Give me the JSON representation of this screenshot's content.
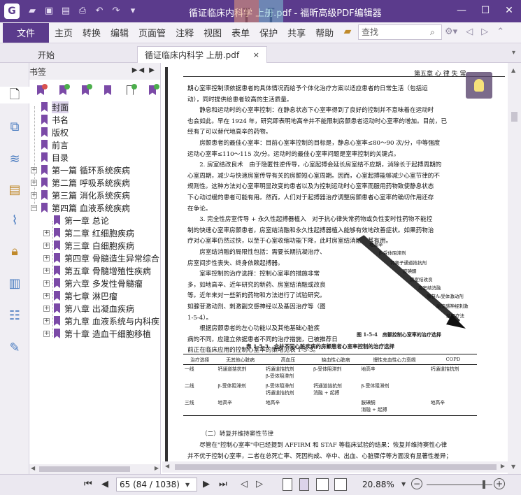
{
  "titlebar": {
    "title": "循证临床内科学 上册.pdf - 福昕高级PDF编辑器",
    "logo": "G",
    "quick_access": [
      "folder-open-icon",
      "save-icon",
      "save-as-icon",
      "print-icon",
      "undo-icon",
      "redo-icon",
      "customize-dropdown-icon"
    ],
    "watermark_left": "I",
    "watermark_right": "I",
    "controls": [
      "minimize",
      "maximize",
      "close"
    ]
  },
  "menu": {
    "file": "文件",
    "items": [
      "主页",
      "转换",
      "编辑",
      "页面管",
      "注释",
      "视图",
      "表单",
      "保护",
      "共享",
      "帮助"
    ],
    "search_placeholder": "查找"
  },
  "tabs": {
    "home": "开始",
    "doc": "循证临床内科学 上册.pdf",
    "close_glyph": "×"
  },
  "bookmarks": {
    "header": "书签",
    "controls": "▶◀ ▶",
    "items": [
      {
        "label": "封面",
        "level": 0,
        "selected": true,
        "expandable": false
      },
      {
        "label": "书名",
        "level": 0,
        "expandable": false
      },
      {
        "label": "版权",
        "level": 0,
        "expandable": false
      },
      {
        "label": "前言",
        "level": 0,
        "expandable": false
      },
      {
        "label": "目录",
        "level": 0,
        "expandable": false
      },
      {
        "label": "第一篇 循环系统疾病",
        "level": 0,
        "expandable": true,
        "expanded": false
      },
      {
        "label": "第二篇 呼吸系统疾病",
        "level": 0,
        "expandable": true,
        "expanded": false
      },
      {
        "label": "第三篇 消化系统疾病",
        "level": 0,
        "expandable": true,
        "expanded": false
      },
      {
        "label": "第四篇 血液系统疾病",
        "level": 0,
        "expandable": true,
        "expanded": true
      },
      {
        "label": "第一章 总论",
        "level": 1,
        "expandable": false
      },
      {
        "label": "第二章 红细胞疾病",
        "level": 1,
        "expandable": true,
        "expanded": false
      },
      {
        "label": "第三章 白细胞疾病",
        "level": 1,
        "expandable": true,
        "expanded": false
      },
      {
        "label": "第四章 骨髓造生异常综合",
        "level": 1,
        "expandable": true,
        "expanded": false
      },
      {
        "label": "第五章 骨髓增殖性疾病",
        "level": 1,
        "expandable": true,
        "expanded": false
      },
      {
        "label": "第六章 多发性骨髓瘤",
        "level": 1,
        "expandable": true,
        "expanded": false
      },
      {
        "label": "第七章 淋巴瘤",
        "level": 1,
        "expandable": true,
        "expanded": false
      },
      {
        "label": "第八章 出凝血疾病",
        "level": 1,
        "expandable": true,
        "expanded": false
      },
      {
        "label": "第九章 血液系统与内科疾",
        "level": 1,
        "expandable": true,
        "expanded": false
      },
      {
        "label": "第十章 造血干细胞移植",
        "level": 1,
        "expandable": true,
        "expanded": false
      }
    ]
  },
  "document": {
    "running_head": "第五章  心 律 失 常",
    "paragraphs": [
      "期心室率控制须依据患者的具体情况而给予个体化治疗方案以适应患者的日常生活（包括运",
      "动），同时提供给患者较高的生活质量。",
      "　　静息和运动时的心室率控制：在静息状态下心室率得到了良好的控制并不意味着在运动时",
      "也会如此。早在 1924 年，研究即表明地高辛并不能限制房颤患者运动时心室率的增加。目前，已",
      "经有了可以替代地高辛的药物。",
      "　　房颤患者的最佳心室率：目前心室率控制的目标是，静息心室率≤80～90 次/分，中等强度",
      "运动心室率≤110～115 次/分。运动时的最佳心室率问题是室率控制的关键点。",
      "　　2. 房室结改良术　由于隐匿性逆传导，心室起搏会延长房室结不应期，消除长于起搏周期的",
      "心室周期，减少与快速房室传导有关的房颤短心室周期。因而，心室起搏能够减少心室节律的不",
      "规则性。这种方法对心室率明显改变的患者以及为控制运动时心室率而服用药物致使静息状态",
      "下心动过缓的患者可能有用。然而，人们对于起搏器治疗调整房颤患者心室率的确切作用还存",
      "在争论。",
      "　　3. 完全性房室传导 + 永久性起搏器植入　对于抗心律失常药物或负性变时性药物不能控",
      "制的快速心室率房颤患者，房室结消融和永久性起搏器植入能够有效地改善症状。如果药物治",
      "疗对心室率仍然过快，以至于心室收缩功能下降，此时房室结消融尤其有用。",
      "　　房室结消融的局限性包括：需要长期抗凝治疗、",
      "房室间步性丧失、终身依赖起搏器。",
      "　　室率控制的治疗选择：控制心室率的措施非常",
      "多，如地高辛、近年研究的新药、房室结消融或改良",
      "等。近年来对一些新的药物和方法进行了试验研究。",
      "如腺苷激动剂、刺激副交感神经以及基因治疗等（图",
      "1-5-4）。",
      "　　根据房颤患者的左心功能以及其他基础心脏疾",
      "病的不同，应建立依据患者不同的治疗措施，已被推荐日",
      "前正在临床应用的控制心室率的策略见表 1-5-3。"
    ],
    "figure_labels": [
      "地高辛",
      "β-受体阻滞剂",
      "钙离子通道拮抗剂",
      "胺碘酮",
      "房室结改良",
      "房室结消融",
      "腺苷A₁受体激动剂",
      "副交感神经刺激",
      "基因疗法"
    ],
    "figure_caption": "图 1-5-4　房颤控制心室率的治疗选择",
    "table_caption": "表 1-5-3　合并不同心脏疾病的房颤患者心室率控制的治疗选择",
    "table": {
      "headers": [
        "治疗选择",
        "无其他心脏病",
        "高血压",
        "缺血性心脏病",
        "慢性充血性心力衰竭",
        "COPD"
      ],
      "rows": [
        [
          "一线",
          "钙通道拮抗剂",
          "钙通道拮抗剂\nβ-受体阻滞剂",
          "β-受体阻滞剂",
          "地高辛",
          "钙通道拮抗剂"
        ],
        [
          "二线",
          "β-受体阻滞剂",
          "β-受体阻滞剂\n钙通道拮抗剂",
          "钙通道拮抗剂\n消融 + 起搏",
          "β-受体阻滞剂",
          ""
        ],
        [
          "三线",
          "地高辛",
          "地高辛",
          "",
          "胺碘酮\n消融 + 起搏",
          "地高辛"
        ]
      ]
    },
    "section_title": "（二）转复并维持窦性节律",
    "tail_lines": [
      "　　尽管在\"控制心室率\"中已经提到 AFFIRM 和 STAF 等临床试验的结果：恢复并维持窦性心律",
      "并不优于控制心室率，二者在总死亡率、死因构成、卒中、出血、心脏骤停等方面没有显著性差异；"
    ]
  },
  "statusbar": {
    "page_value": "65 (84 / 1038)",
    "zoom": "20.88%"
  }
}
